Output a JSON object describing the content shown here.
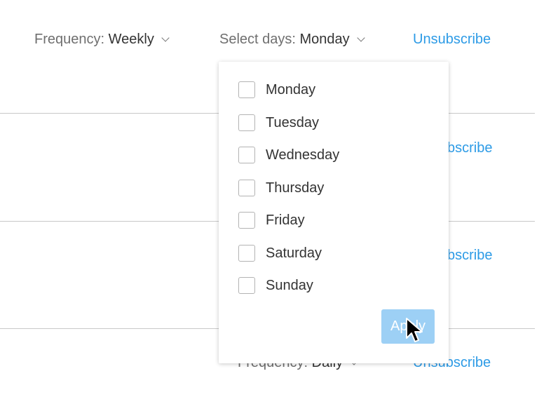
{
  "rows": [
    {
      "frequency_label": "Frequency:",
      "frequency_value": "Weekly",
      "days_label": "Select days:",
      "days_value": "Monday",
      "unsubscribe": "Unsubscribe"
    },
    {
      "unsubscribe_partial": "bscribe"
    },
    {
      "unsubscribe_partial": "bscribe"
    },
    {
      "frequency_label": "Frequency:",
      "frequency_value": "Daily",
      "unsubscribe": "Unsubscribe"
    }
  ],
  "dropdown": {
    "options": [
      "Monday",
      "Tuesday",
      "Wednesday",
      "Thursday",
      "Friday",
      "Saturday",
      "Sunday"
    ],
    "apply_label": "Apply"
  },
  "colors": {
    "link": "#2d9be6",
    "apply_bg": "#9dd0f5"
  },
  "icons": {
    "chevron": "chevron-down-icon",
    "cursor": "mouse-pointer-icon"
  }
}
